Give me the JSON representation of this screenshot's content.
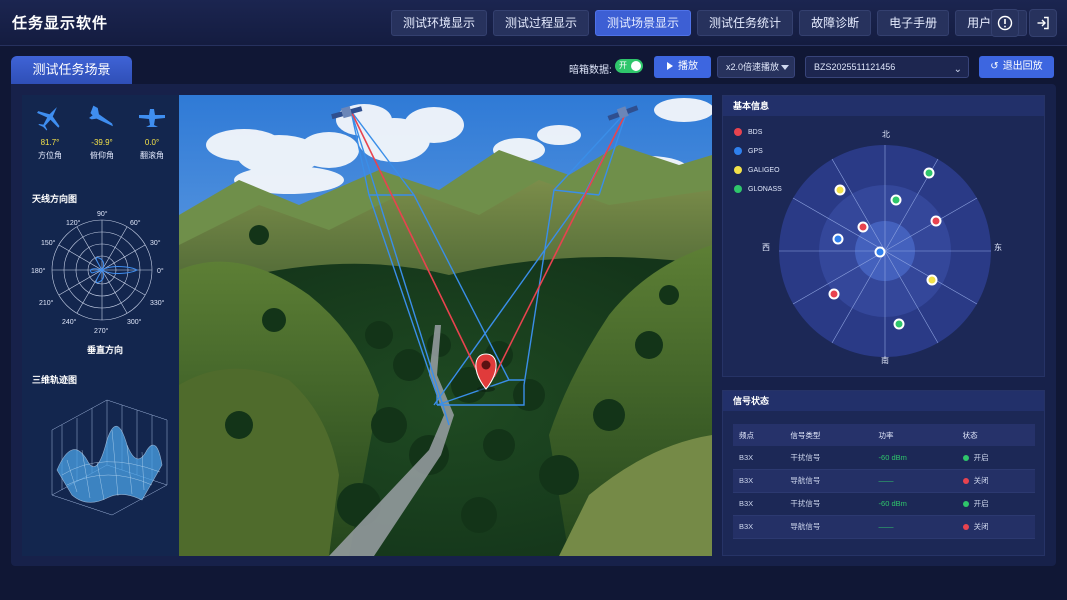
{
  "app": {
    "title": "任务显示软件"
  },
  "nav": {
    "items": [
      {
        "label": "测试环境显示",
        "active": false
      },
      {
        "label": "测试过程显示",
        "active": false
      },
      {
        "label": "测试场景显示",
        "active": true
      },
      {
        "label": "测试任务统计",
        "active": false
      },
      {
        "label": "故障诊断",
        "active": false
      },
      {
        "label": "电子手册",
        "active": false
      },
      {
        "label": "用户管理",
        "active": false
      }
    ],
    "info_icon": "info-icon",
    "logout_icon": "logout-icon"
  },
  "page_tab": "测试任务场景",
  "controls": {
    "blackbox_label": "暗箱数据:",
    "toggle_label": "开",
    "play_label": "播放",
    "speed_value": "x2.0倍速播放",
    "record_id": "BZS2025511121456",
    "exit_label": "退出回放"
  },
  "attitude": [
    {
      "value": "81.7°",
      "label": "方位角",
      "icon": "plane-top-icon"
    },
    {
      "value": "-39.9°",
      "label": "俯仰角",
      "icon": "plane-side-icon"
    },
    {
      "value": "0.0°",
      "label": "翻滚角",
      "icon": "plane-front-icon"
    }
  ],
  "antenna": {
    "title": "天线方向图",
    "angles": [
      "90°",
      "60°",
      "30°",
      "0°",
      "330°",
      "300°",
      "270°",
      "240°",
      "210°",
      "180°",
      "150°",
      "120°"
    ],
    "subtitle": "垂直方向"
  },
  "trajectory": {
    "title": "三维轨迹图"
  },
  "basic_info": {
    "title": "基本信息",
    "legend": [
      {
        "name": "BDS",
        "color": "#e8434f"
      },
      {
        "name": "GPS",
        "color": "#2f80ed"
      },
      {
        "name": "GALIGEO",
        "color": "#f2e14a"
      },
      {
        "name": "GLONASS",
        "color": "#2fc66b"
      }
    ],
    "directions": {
      "north": "北",
      "south": "南",
      "east": "东",
      "west": "西"
    }
  },
  "signal": {
    "title": "信号状态",
    "headers": [
      "频点",
      "信号类型",
      "功率",
      "状态"
    ],
    "rows": [
      {
        "freq": "B3X",
        "type": "干扰信号",
        "power": "-60 dBm",
        "status": "开启",
        "on": true
      },
      {
        "freq": "B3X",
        "type": "导航信号",
        "power": "——",
        "status": "关闭",
        "on": false
      },
      {
        "freq": "B3X",
        "type": "干扰信号",
        "power": "-60 dBm",
        "status": "开启",
        "on": true
      },
      {
        "freq": "B3X",
        "type": "导航信号",
        "power": "——",
        "status": "关闭",
        "on": false
      }
    ]
  }
}
